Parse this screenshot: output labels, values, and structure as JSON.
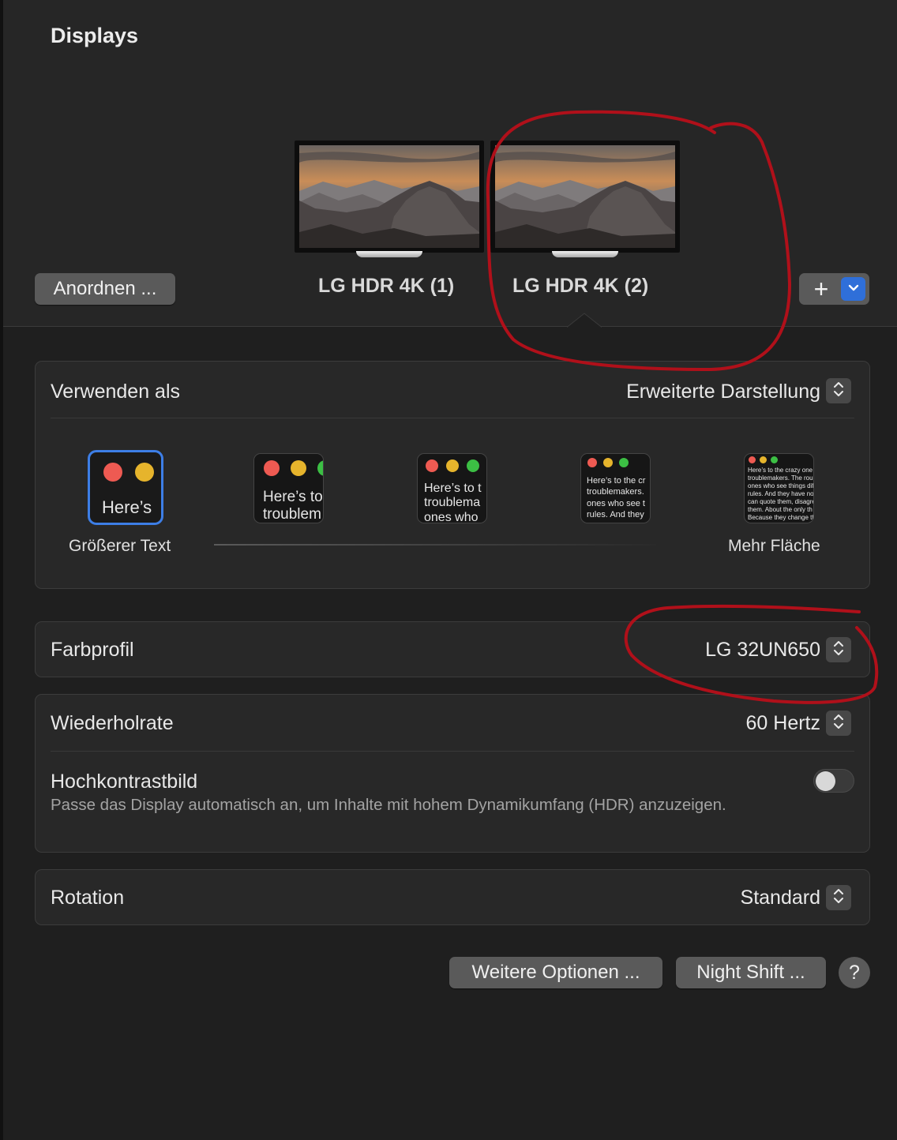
{
  "window": {
    "title": "Displays"
  },
  "arrange": {
    "label": "Anordnen ..."
  },
  "displays": [
    {
      "label": "LG HDR 4K (1)"
    },
    {
      "label": "LG HDR 4K (2)"
    }
  ],
  "add": {
    "plus": "+"
  },
  "use_as": {
    "label": "Verwenden als",
    "value": "Erweiterte Darstellung"
  },
  "resolution": {
    "options": [
      {
        "preview": "Here’s"
      },
      {
        "preview": "Here’s to\ntroublem"
      },
      {
        "preview": "Here’s to t\ntroublema\nones who"
      },
      {
        "preview": "Here’s to the cr\ntroublemakers.\nones who see t\nrules. And they"
      },
      {
        "preview": "Here’s to the crazy one\ntroublemakers. The rou\nones who see things dif\nrules. And they have no\ncan quote them, disagre\nthem. About the only th\nBecause they change th"
      }
    ],
    "left_caption": "Größerer Text",
    "right_caption": "Mehr Fläche"
  },
  "color_profile": {
    "label": "Farbprofil",
    "value": "LG 32UN650"
  },
  "refresh_rate": {
    "label": "Wiederholrate",
    "value": "60 Hertz"
  },
  "hdr": {
    "label": "Hochkontrastbild",
    "description": "Passe das Display automatisch an, um Inhalte mit hohem Dynamikumfang (HDR) anzuzeigen.",
    "enabled": false
  },
  "rotation": {
    "label": "Rotation",
    "value": "Standard"
  },
  "footer": {
    "more_options": "Weitere Optionen ...",
    "night_shift": "Night Shift ...",
    "help": "?"
  },
  "colors": {
    "accent": "#2f6fd9",
    "annotation": "#b0101a"
  }
}
